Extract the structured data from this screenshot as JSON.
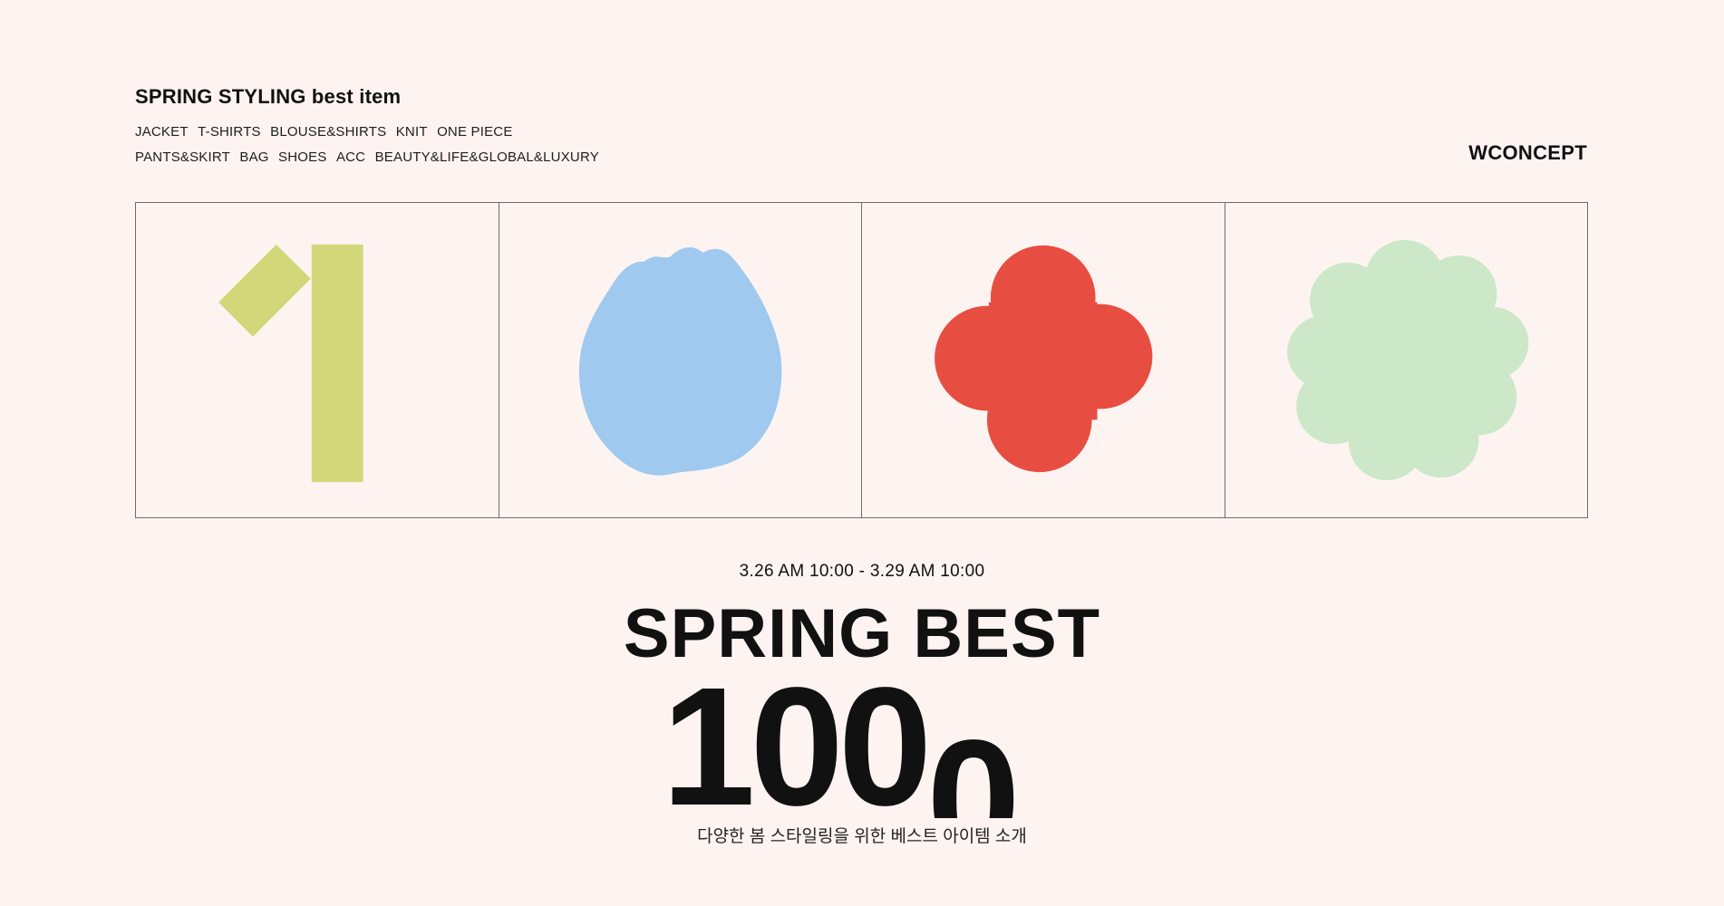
{
  "header": {
    "title": "SPRING STYLING best item",
    "categories_row1": [
      "JACKET",
      "T-SHIRTS",
      "BLOUSE&SHIRTS",
      "KNIT",
      "ONE PIECE"
    ],
    "categories_row2": [
      "PANTS&SKIRT",
      "BAG",
      "SHOES",
      "ACC",
      "BEAUTY&LIFE&GLOBAL&LUXURY"
    ],
    "logo": "WCONCEPT"
  },
  "tiles": [
    {
      "icon": "number-one-shape-icon",
      "color": "#d4d67a"
    },
    {
      "icon": "blue-blob-shape-icon",
      "color": "#9fc9ee"
    },
    {
      "icon": "red-clover-shape-icon",
      "color": "#e84d41"
    },
    {
      "icon": "green-flower-shape-icon",
      "color": "#cde8c8"
    }
  ],
  "event": {
    "dates": "3.26 AM 10:00 - 3.29 AM 10:00",
    "title": "SPRING BEST",
    "number_main": "100",
    "number_drop": "0",
    "subtitle": "다양한 봄 스타일링을 위한 베스트 아이템 소개"
  }
}
